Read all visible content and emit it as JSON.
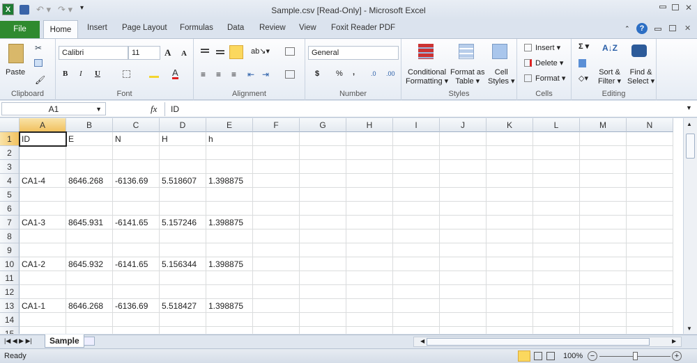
{
  "window": {
    "title": "Sample.csv  [Read-Only]  -  Microsoft Excel"
  },
  "tabs": [
    "File",
    "Home",
    "Insert",
    "Page Layout",
    "Formulas",
    "Data",
    "Review",
    "View",
    "Foxit Reader PDF"
  ],
  "ribbon": {
    "clipboard": {
      "label": "Clipboard",
      "paste": "Paste"
    },
    "font": {
      "label": "Font",
      "name": "Calibri",
      "size": "11",
      "bold": "B",
      "italic": "I",
      "underline": "U",
      "grow": "A",
      "shrink": "A",
      "color": "A"
    },
    "alignment": {
      "label": "Alignment"
    },
    "number": {
      "label": "Number",
      "format": "General",
      "currency": "$",
      "percent": "%",
      "comma": ",",
      "inc": ".0",
      "dec": ".00"
    },
    "styles": {
      "label": "Styles",
      "conditional": [
        "Conditional",
        "Formatting ▾"
      ],
      "table": [
        "Format as",
        "Table ▾"
      ],
      "cell": [
        "Cell",
        "Styles ▾"
      ]
    },
    "cells": {
      "label": "Cells",
      "insert": "Insert ▾",
      "delete": "Delete ▾",
      "format": "Format ▾"
    },
    "editing": {
      "label": "Editing",
      "sum": "Σ ▾",
      "sort": [
        "Sort &",
        "Filter ▾"
      ],
      "find": [
        "Find &",
        "Select ▾"
      ]
    }
  },
  "formula_bar": {
    "name_box": "A1",
    "fx": "fx",
    "value": "ID"
  },
  "columns": [
    "A",
    "B",
    "C",
    "D",
    "E",
    "F",
    "G",
    "H",
    "I",
    "J",
    "K",
    "L",
    "M",
    "N"
  ],
  "rows": [
    "1",
    "2",
    "3",
    "4",
    "5",
    "6",
    "7",
    "8",
    "9",
    "10",
    "11",
    "12",
    "13",
    "14",
    "15"
  ],
  "cells": [
    [
      "ID",
      "E",
      "N",
      "H",
      "h"
    ],
    [],
    [],
    [
      "CA1-4",
      "8646.268",
      "-6136.69",
      "5.518607",
      "1.398875"
    ],
    [],
    [],
    [
      "CA1-3",
      "8645.931",
      "-6141.65",
      "5.157246",
      "1.398875"
    ],
    [],
    [],
    [
      "CA1-2",
      "8645.932",
      "-6141.65",
      "5.156344",
      "1.398875"
    ],
    [],
    [],
    [
      "CA1-1",
      "8646.268",
      "-6136.69",
      "5.518427",
      "1.398875"
    ],
    [],
    []
  ],
  "sheets": [
    "Sample"
  ],
  "status": {
    "text": "Ready",
    "zoom": "100%",
    "zoom_level": 100
  }
}
